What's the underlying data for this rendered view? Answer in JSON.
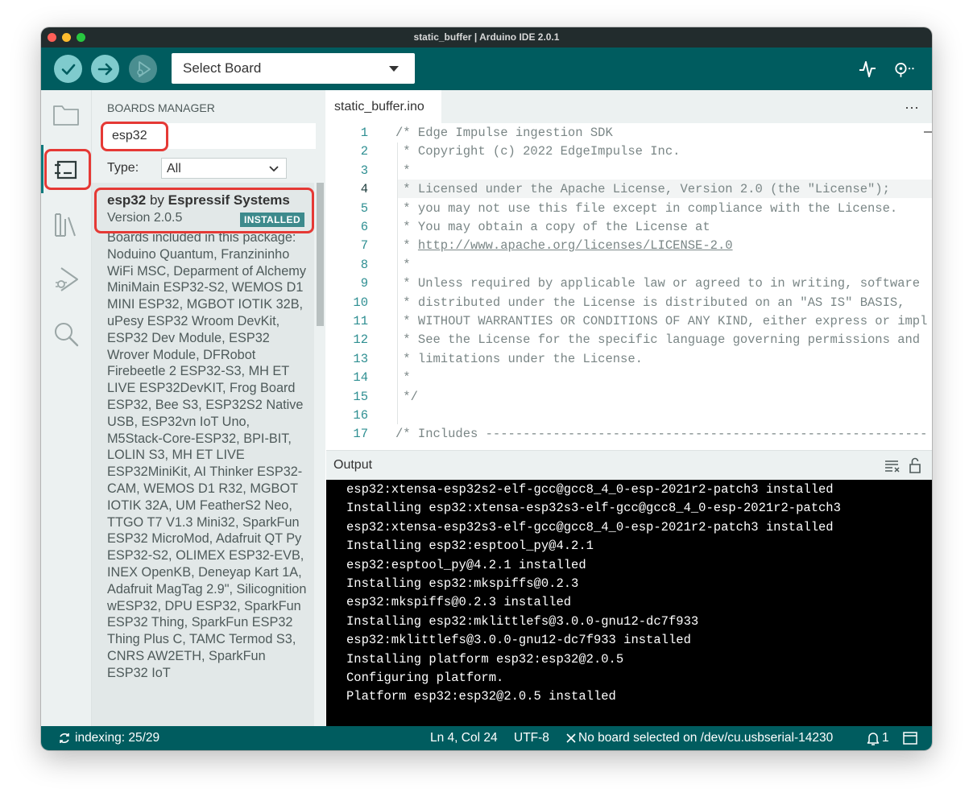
{
  "window": {
    "title": "static_buffer | Arduino IDE 2.0.1"
  },
  "toolbar": {
    "verify_icon": "checkmark-icon",
    "upload_icon": "arrow-right-icon",
    "debug_icon": "debug-icon",
    "board_select": "Select Board",
    "plotter_icon": "serial-plotter-icon",
    "monitor_icon": "serial-monitor-icon"
  },
  "activity": {
    "items": [
      "sketchbook-folder-icon",
      "boards-manager-icon",
      "library-manager-icon",
      "debug-icon",
      "search-icon"
    ],
    "active": "boards-manager-icon"
  },
  "boards_manager": {
    "title": "BOARDS MANAGER",
    "search_value": "esp32",
    "type_label": "Type:",
    "type_value": "All",
    "result": {
      "name": "esp32",
      "by": "by",
      "author": "Espressif Systems",
      "version": "Version 2.0.5",
      "badge": "INSTALLED",
      "description": "Boards included in this package: Noduino Quantum, Franzininho WiFi MSC, Deparment of Alchemy MiniMain ESP32-S2, WEMOS D1 MINI ESP32, MGBOT IOTIK 32B, uPesy ESP32 Wroom DevKit, ESP32 Dev Module, ESP32 Wrover Module, DFRobot Firebeetle 2 ESP32-S3, MH ET LIVE ESP32DevKIT, Frog Board ESP32, Bee S3, ESP32S2 Native USB, ESP32vn IoT Uno, M5Stack-Core-ESP32, BPI-BIT, LOLIN S3, MH ET LIVE ESP32MiniKit, AI Thinker ESP32-CAM, WEMOS D1 R32, MGBOT IOTIK 32A, UM FeatherS2 Neo, TTGO T7 V1.3 Mini32, SparkFun ESP32 MicroMod, Adafruit QT Py ESP32-S2, OLIMEX ESP32-EVB, INEX OpenKB, Deneyap Kart 1A, Adafruit MagTag 2.9\", Silicognition wESP32, DPU ESP32, SparkFun ESP32 Thing, SparkFun ESP32 Thing Plus C, TAMC Termod S3, CNRS AW2ETH, SparkFun ESP32 IoT"
    }
  },
  "editor": {
    "tab": "static_buffer.ino",
    "more": "···",
    "lines": [
      {
        "n": "1",
        "text": "/* Edge Impulse ingestion SDK"
      },
      {
        "n": "2",
        "text": " * Copyright (c) 2022 EdgeImpulse Inc."
      },
      {
        "n": "3",
        "text": " *"
      },
      {
        "n": "4",
        "text": " * Licensed under the Apache License, Version 2.0 (the \"License\");"
      },
      {
        "n": "5",
        "text": " * you may not use this file except in compliance with the License."
      },
      {
        "n": "6",
        "text": " * You may obtain a copy of the License at"
      },
      {
        "n": "7",
        "text": " * http://www.apache.org/licenses/LICENSE-2.0"
      },
      {
        "n": "8",
        "text": " *"
      },
      {
        "n": "9",
        "text": " * Unless required by applicable law or agreed to in writing, software"
      },
      {
        "n": "10",
        "text": " * distributed under the License is distributed on an \"AS IS\" BASIS,"
      },
      {
        "n": "11",
        "text": " * WITHOUT WARRANTIES OR CONDITIONS OF ANY KIND, either express or impl"
      },
      {
        "n": "12",
        "text": " * See the License for the specific language governing permissions and"
      },
      {
        "n": "13",
        "text": " * limitations under the License."
      },
      {
        "n": "14",
        "text": " *"
      },
      {
        "n": "15",
        "text": " */"
      },
      {
        "n": "16",
        "text": ""
      },
      {
        "n": "17",
        "text": "/* Includes -----------------------------------------------------------"
      }
    ],
    "current_line": "4"
  },
  "output": {
    "label": "Output",
    "clear_icon": "clear-output-icon",
    "lock_icon": "unlock-scroll-icon",
    "lines": [
      "esp32:xtensa-esp32s2-elf-gcc@gcc8_4_0-esp-2021r2-patch3 installed",
      "Installing esp32:xtensa-esp32s3-elf-gcc@gcc8_4_0-esp-2021r2-patch3",
      "esp32:xtensa-esp32s3-elf-gcc@gcc8_4_0-esp-2021r2-patch3 installed",
      "Installing esp32:esptool_py@4.2.1",
      "esp32:esptool_py@4.2.1 installed",
      "Installing esp32:mkspiffs@0.2.3",
      "esp32:mkspiffs@0.2.3 installed",
      "Installing esp32:mklittlefs@3.0.0-gnu12-dc7f933",
      "esp32:mklittlefs@3.0.0-gnu12-dc7f933 installed",
      "Installing platform esp32:esp32@2.0.5",
      "Configuring platform.",
      "Platform esp32:esp32@2.0.5 installed"
    ]
  },
  "status": {
    "indexing": "indexing: 25/29",
    "position": "Ln 4, Col 24",
    "encoding": "UTF-8",
    "board": "No board selected on /dev/cu.usbserial-14230",
    "notifications": "1",
    "sync_icon": "sync-icon",
    "close_icon": "close-icon",
    "bell_icon": "notification-bell-icon",
    "panel_icon": "toggle-panel-icon"
  },
  "colors": {
    "accent": "#005c5f",
    "highlight": "#e53935",
    "badge": "#3d8a8c",
    "line_number": "#2f8f92"
  }
}
